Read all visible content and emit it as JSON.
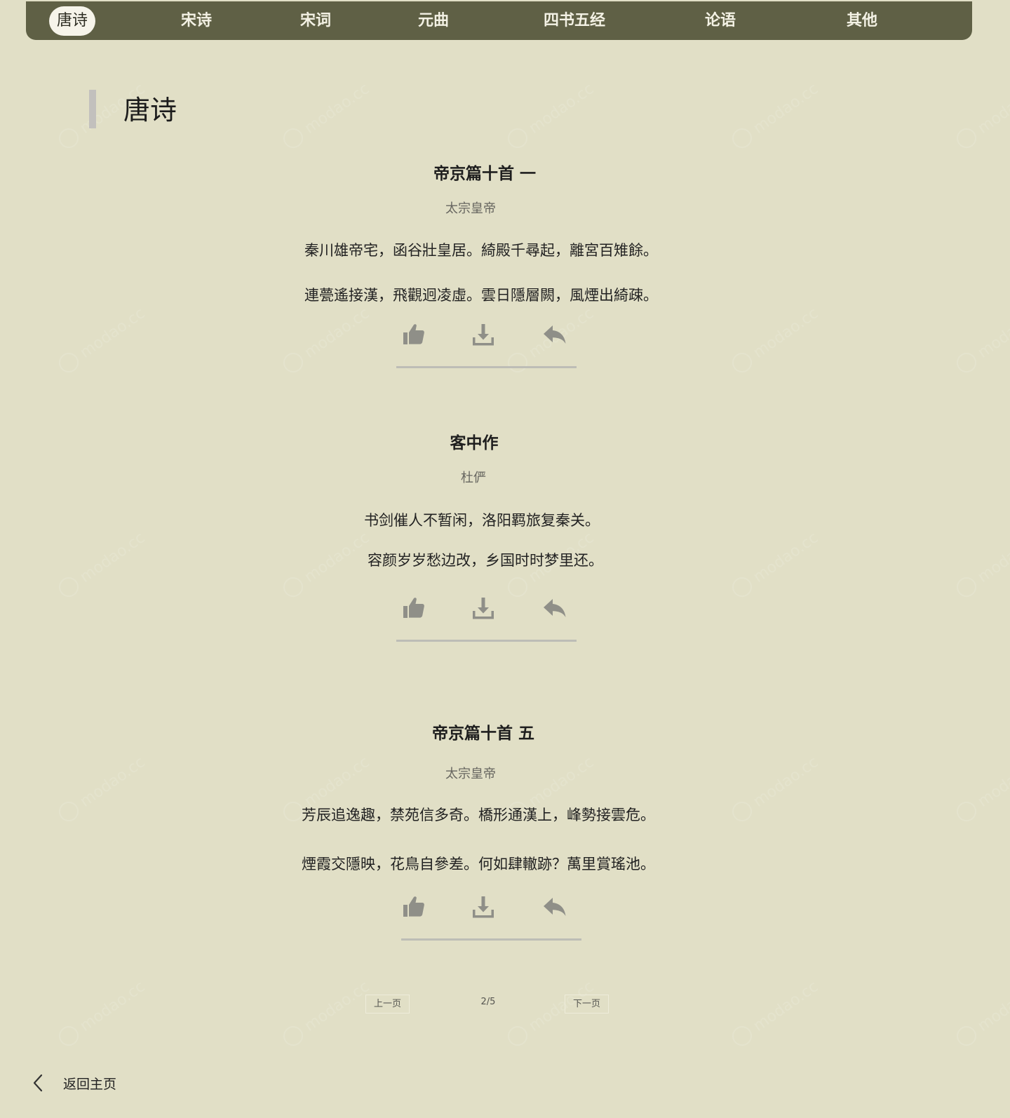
{
  "nav": {
    "items": [
      {
        "label": "唐诗",
        "active": true
      },
      {
        "label": "宋诗",
        "active": false
      },
      {
        "label": "宋词",
        "active": false
      },
      {
        "label": "元曲",
        "active": false
      },
      {
        "label": "四书五经",
        "active": false
      },
      {
        "label": "论语",
        "active": false
      },
      {
        "label": "其他",
        "active": false
      }
    ]
  },
  "section": {
    "title": "唐诗"
  },
  "poems": [
    {
      "title": "帝京篇十首 一",
      "author": "太宗皇帝",
      "lines": [
        "秦川雄帝宅，函谷壯皇居。綺殿千尋起，離宮百雉餘。",
        "連甍遙接漢，飛觀迥凌虛。雲日隱層闕，風煙出綺疎。"
      ]
    },
    {
      "title": "客中作",
      "author": "杜俨",
      "lines": [
        "书剑催人不暂闲，洛阳羁旅复秦关。",
        "容颜岁岁愁边改，乡国时时梦里还。"
      ]
    },
    {
      "title": "帝京篇十首 五",
      "author": "太宗皇帝",
      "lines": [
        "芳辰追逸趣，禁苑信多奇。橋形通漢上，峰勢接雲危。",
        "煙霞交隱映，花鳥自參差。何如肆轍跡？萬里賞瑤池。"
      ]
    }
  ],
  "actions": {
    "like_icon": "thumbs-up-icon",
    "download_icon": "download-icon",
    "reply_icon": "reply-icon"
  },
  "pagination": {
    "prev_label": "上一页",
    "indicator": "2/5",
    "next_label": "下一页"
  },
  "back": {
    "label": "返回主页",
    "icon": "chevron-left-icon"
  },
  "watermark": {
    "text": "modao.cc"
  },
  "colors": {
    "background": "#e1dfc6",
    "nav_background": "#5f6045",
    "nav_active_pill": "#f6f4ea",
    "icon_gray": "#8f8f88",
    "divider": "#bdbdb6"
  }
}
